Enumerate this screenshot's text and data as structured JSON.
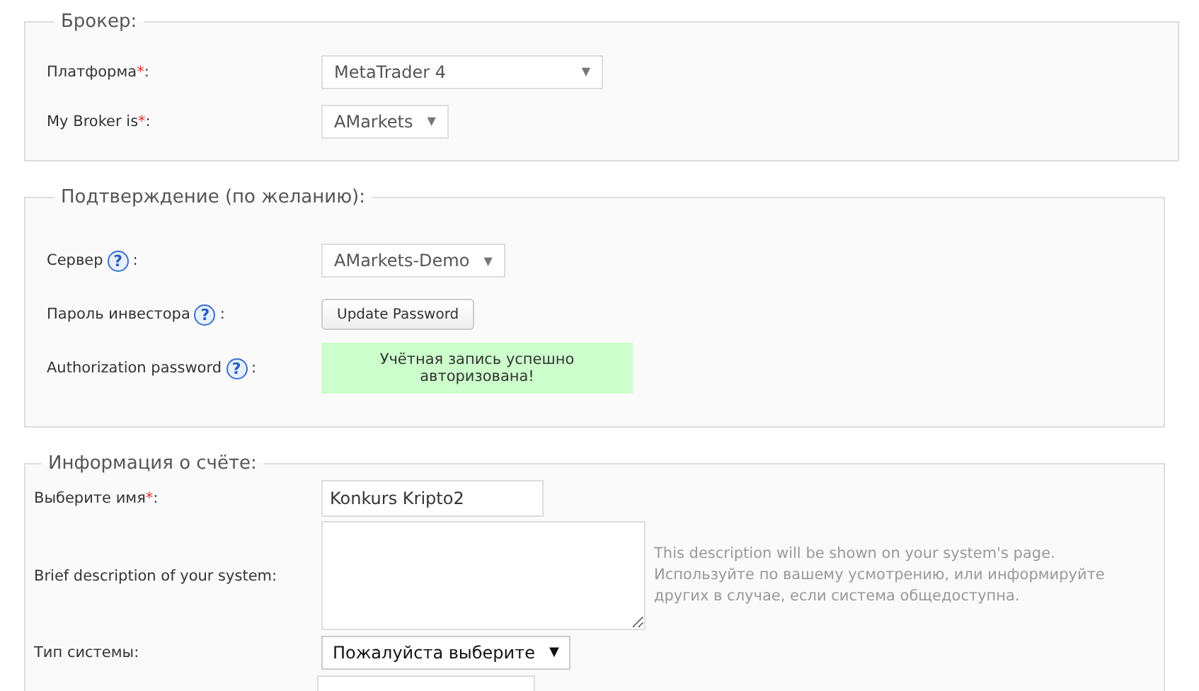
{
  "sections": [
    {
      "legend": "Брокер:",
      "rows": [
        {
          "kind": "select",
          "label": "Платформа",
          "mark": "*",
          "after": ":",
          "value": "MetaTrader 4",
          "arrow": "▼"
        },
        {
          "kind": "select",
          "label": "My Broker is",
          "mark": "*",
          "after": ":",
          "value": "AMarkets",
          "arrow": "▼"
        }
      ]
    },
    {
      "legend": "Подтверждение (по желанию):",
      "rows": [
        {
          "kind": "select",
          "label": "Сервер",
          "help": "?",
          "after": ":",
          "value": "AMarkets-Demo",
          "arrow": "▼"
        },
        {
          "kind": "button",
          "label": "Пароль инвестора",
          "help": "?",
          "after": ":",
          "value": "Update Password"
        },
        {
          "kind": "status",
          "label": "Authorization password",
          "help": "?",
          "after": ":",
          "value": "Учётная запись успешно авторизована!"
        }
      ]
    },
    {
      "legend": "Информация о счёте:",
      "rows": [
        {
          "kind": "input",
          "label": "Выберите имя",
          "mark": "*",
          "after": ":",
          "value": "Konkurs Kripto2"
        },
        {
          "kind": "textarea",
          "label": "Brief description of your system:",
          "hint": [
            "This description will be shown on your system's page.",
            "Используйте по вашему усмотрению, или информируйте других в случае, если система общедоступна."
          ]
        },
        {
          "kind": "dropdown",
          "label": "Тип системы:",
          "value": "Пожалуйста выберите",
          "arrow": "▼"
        }
      ]
    }
  ]
}
